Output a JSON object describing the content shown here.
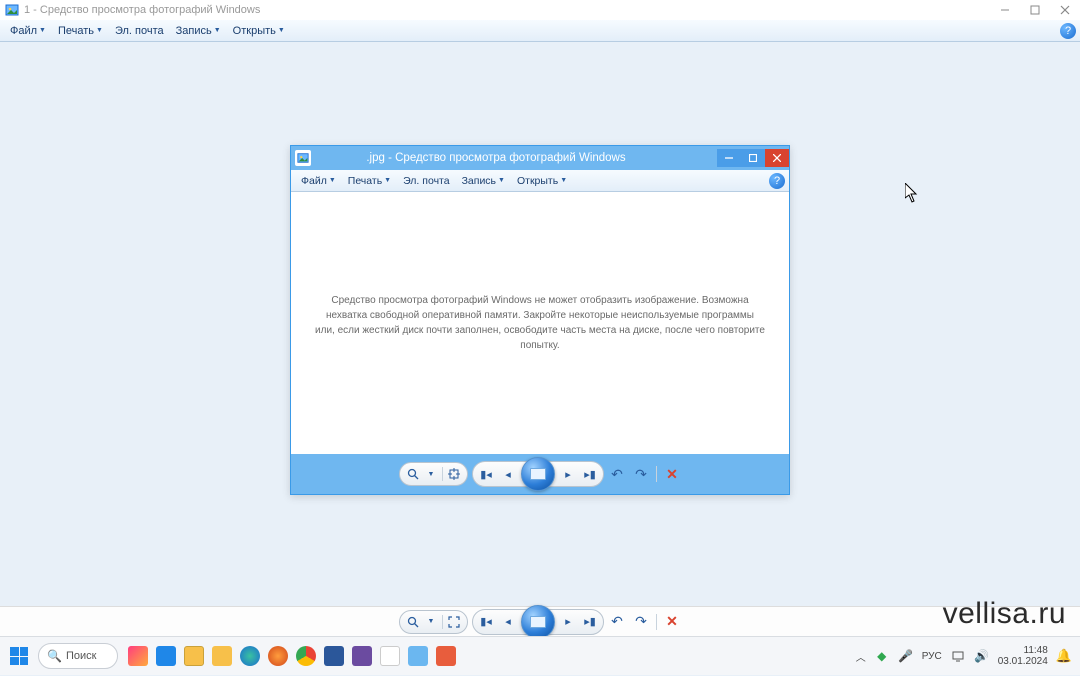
{
  "outer": {
    "title": "1 - Средство просмотра фотографий Windows",
    "menu": {
      "file": "Файл",
      "print": "Печать",
      "email": "Эл. почта",
      "burn": "Запись",
      "open": "Открыть"
    }
  },
  "inner": {
    "title": ".jpg - Средство просмотра фотографий Windows",
    "menu": {
      "file": "Файл",
      "print": "Печать",
      "email": "Эл. почта",
      "burn": "Запись",
      "open": "Открыть"
    },
    "error_msg": "Средство просмотра фотографий Windows не может отобразить изображение. Возможна нехватка свободной оперативной памяти. Закройте некоторые неиспользуемые программы или, если жесткий диск почти заполнен, освободите часть места на диске, после чего повторите попытку."
  },
  "watermark": "vellisa.ru",
  "taskbar": {
    "search_placeholder": "Поиск",
    "lang": "РУС",
    "time": "11:48",
    "date": "03.01.2024"
  }
}
